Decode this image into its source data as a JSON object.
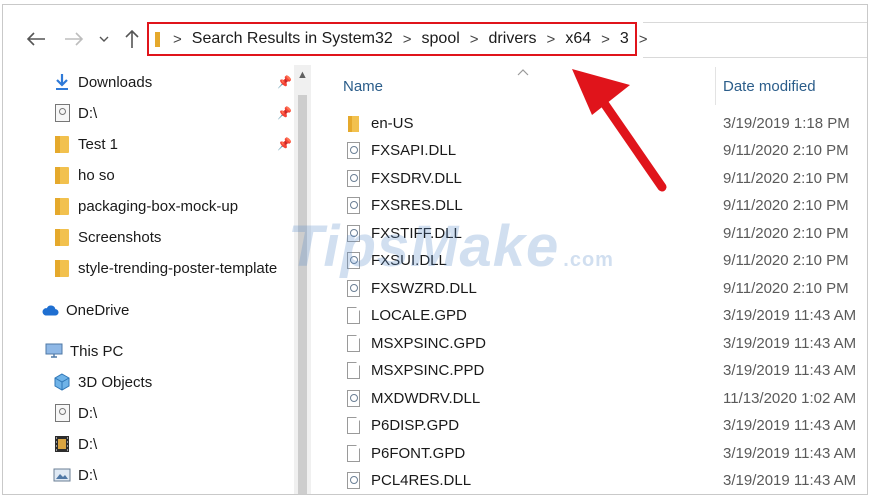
{
  "address": {
    "crumbs": [
      "Search Results in System32",
      "spool",
      "drivers",
      "x64",
      "3"
    ],
    "separator": ">"
  },
  "nav": {
    "back_icon": "arrow-left-icon",
    "forward_icon": "arrow-right-icon",
    "recent_icon": "chevron-down-icon",
    "up_icon": "arrow-up-icon"
  },
  "sidebar": {
    "items": [
      {
        "label": "Downloads",
        "icon": "download-icon",
        "pinned": true
      },
      {
        "label": "D:\\",
        "icon": "drive-icon",
        "pinned": true
      },
      {
        "label": "Test 1",
        "icon": "folder-icon",
        "pinned": true
      },
      {
        "label": "ho so",
        "icon": "folder-icon",
        "pinned": false
      },
      {
        "label": "packaging-box-mock-up",
        "icon": "folder-icon",
        "pinned": false
      },
      {
        "label": "Screenshots",
        "icon": "folder-icon",
        "pinned": false
      },
      {
        "label": "style-trending-poster-template",
        "icon": "folder-icon",
        "pinned": false
      },
      {
        "label": "OneDrive",
        "icon": "cloud-icon",
        "pinned": false
      },
      {
        "label": "This PC",
        "icon": "pc-icon",
        "pinned": false
      },
      {
        "label": "3D Objects",
        "icon": "cube-icon",
        "pinned": false
      },
      {
        "label": "D:\\",
        "icon": "drive-icon",
        "pinned": false
      },
      {
        "label": "D:\\",
        "icon": "film-icon",
        "pinned": false
      },
      {
        "label": "D:\\",
        "icon": "image-drive-icon",
        "pinned": false
      }
    ]
  },
  "files": {
    "columns": {
      "name": "Name",
      "date": "Date modified"
    },
    "rows": [
      {
        "name": "en-US",
        "date": "3/19/2019 1:18 PM",
        "type": "folder"
      },
      {
        "name": "FXSAPI.DLL",
        "date": "9/11/2020 2:10 PM",
        "type": "dll"
      },
      {
        "name": "FXSDRV.DLL",
        "date": "9/11/2020 2:10 PM",
        "type": "dll"
      },
      {
        "name": "FXSRES.DLL",
        "date": "9/11/2020 2:10 PM",
        "type": "dll"
      },
      {
        "name": "FXSTIFF.DLL",
        "date": "9/11/2020 2:10 PM",
        "type": "dll"
      },
      {
        "name": "FXSUI.DLL",
        "date": "9/11/2020 2:10 PM",
        "type": "dll"
      },
      {
        "name": "FXSWZRD.DLL",
        "date": "9/11/2020 2:10 PM",
        "type": "dll"
      },
      {
        "name": "LOCALE.GPD",
        "date": "3/19/2019 11:43 AM",
        "type": "file"
      },
      {
        "name": "MSXPSINC.GPD",
        "date": "3/19/2019 11:43 AM",
        "type": "file"
      },
      {
        "name": "MSXPSINC.PPD",
        "date": "3/19/2019 11:43 AM",
        "type": "file"
      },
      {
        "name": "MXDWDRV.DLL",
        "date": "11/13/2020 1:02 AM",
        "type": "dll"
      },
      {
        "name": "P6DISP.GPD",
        "date": "3/19/2019 11:43 AM",
        "type": "file"
      },
      {
        "name": "P6FONT.GPD",
        "date": "3/19/2019 11:43 AM",
        "type": "file"
      },
      {
        "name": "PCL4RES.DLL",
        "date": "3/19/2019 11:43 AM",
        "type": "dll"
      }
    ]
  },
  "watermark": {
    "text": "TipsMake",
    "suffix": ".com"
  },
  "colors": {
    "highlight": "#e0141b",
    "header_text": "#2b5d8a",
    "folder": "#f2c14e"
  }
}
